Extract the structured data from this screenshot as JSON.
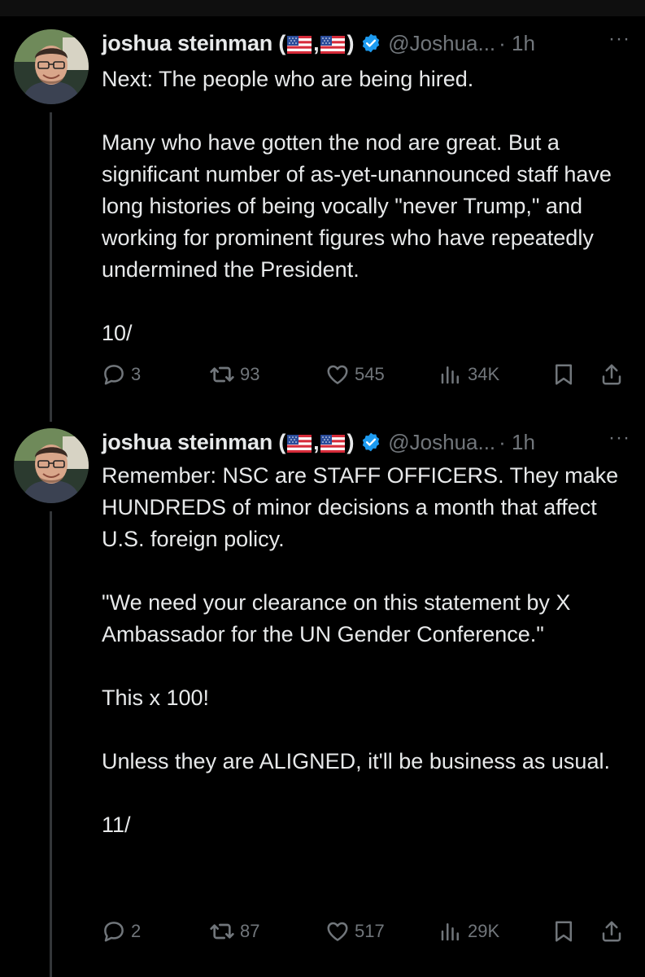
{
  "tweets": [
    {
      "name": "joshua steinman (",
      "name_sep": ",",
      "name_close": ")",
      "handle": "@Joshua...",
      "time": "· 1h",
      "more": "···",
      "paragraphs": [
        "Next: The people who are being hired.",
        "",
        "Many who have gotten the nod are great. But a significant number of as-yet-unannounced staff have long histories of being vocally \"never Trump,\" and working for prominent figures who have repeatedly undermined the President.",
        "",
        "10/"
      ],
      "replies": "3",
      "reposts": "93",
      "likes": "545",
      "views": "34K"
    },
    {
      "name": "joshua steinman (",
      "name_sep": ",",
      "name_close": ")",
      "handle": "@Joshua...",
      "time": "· 1h",
      "more": "···",
      "paragraphs": [
        "Remember: NSC are STAFF OFFICERS. They make HUNDREDS of minor decisions a month that affect U.S. foreign policy.",
        "",
        "\"We need your clearance on this statement by X Ambassador for the UN Gender Conference.\"",
        "",
        "This x 100!",
        "",
        "Unless they are ALIGNED, it'll be business as usual.",
        "",
        "11/"
      ],
      "replies": "2",
      "reposts": "87",
      "likes": "517",
      "views": "29K"
    }
  ],
  "icons": {
    "reply": "reply-icon",
    "repost": "repost-icon",
    "like": "like-icon",
    "views": "views-icon",
    "bookmark": "bookmark-icon",
    "share": "share-icon",
    "verified": "verified-badge-icon",
    "flag": "us-flag-icon"
  },
  "colors": {
    "background": "#000000",
    "text": "#e7e9ea",
    "muted": "#71767b",
    "verified": "#1d9bf0",
    "thread_line": "#333639"
  }
}
